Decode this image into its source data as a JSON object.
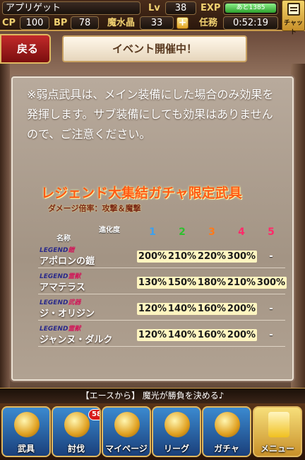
{
  "status": {
    "player_name": "アプリゲット",
    "lv_label": "Lv",
    "lv_value": "38",
    "exp_label": "EXP",
    "exp_remaining": "あと1385",
    "cp_label": "CP",
    "cp_value": "100",
    "bp_label": "BP",
    "bp_value": "78",
    "mana_label": "魔水晶",
    "mana_value": "33",
    "plus_label": "+",
    "mission_label": "任務",
    "mission_timer": "0:52:19",
    "chat_label": "チャット"
  },
  "header": {
    "back_label": "戻る",
    "title": "イベント開催中！"
  },
  "panel": {
    "notice": "※弱点武具は、メイン装備にした場合のみ効果を発揮します。サブ装備にしても効果はありませんので、ご注意ください。",
    "gacha_title": "レジェンド大集結ガチャ限定武具",
    "damage_note": "ダメージ倍率：攻撃＆魔撃",
    "table": {
      "name_header": "名称",
      "level_header": "進化度",
      "levels": [
        "1",
        "2",
        "3",
        "4",
        "5"
      ],
      "level_colors": [
        "#3aa0f0",
        "#2ec02e",
        "#ff7a1a",
        "#ff2a6a",
        "#ff2a6a"
      ],
      "rows": [
        {
          "rarity": "LEGEND",
          "type": "鎧",
          "name": "アポロンの鎧",
          "values": [
            "200%",
            "210%",
            "220%",
            "300%",
            "-"
          ]
        },
        {
          "rarity": "LEGEND",
          "type": "霊獣",
          "name": "アマテラス",
          "values": [
            "130%",
            "150%",
            "180%",
            "210%",
            "300%"
          ]
        },
        {
          "rarity": "LEGEND",
          "type": "武器",
          "name": "ジ・オリジン",
          "values": [
            "120%",
            "140%",
            "160%",
            "200%",
            "-"
          ]
        },
        {
          "rarity": "LEGEND",
          "type": "霊獣",
          "name": "ジャンヌ・ダルク",
          "values": [
            "120%",
            "140%",
            "160%",
            "200%",
            "-"
          ]
        }
      ]
    }
  },
  "ticker": "【エースから】 魔光が勝負を決める♪",
  "menu": [
    {
      "label": "武具",
      "icon": "sword-icon"
    },
    {
      "label": "討伐",
      "icon": "monster-icon",
      "badge": "58"
    },
    {
      "label": "マイページ",
      "icon": "knight-icon"
    },
    {
      "label": "リーグ",
      "icon": "crossed-swords-icon"
    },
    {
      "label": "ガチャ",
      "icon": "treasure-chest-icon"
    },
    {
      "label": "メニュー",
      "icon": "menu-alert-icon"
    }
  ]
}
